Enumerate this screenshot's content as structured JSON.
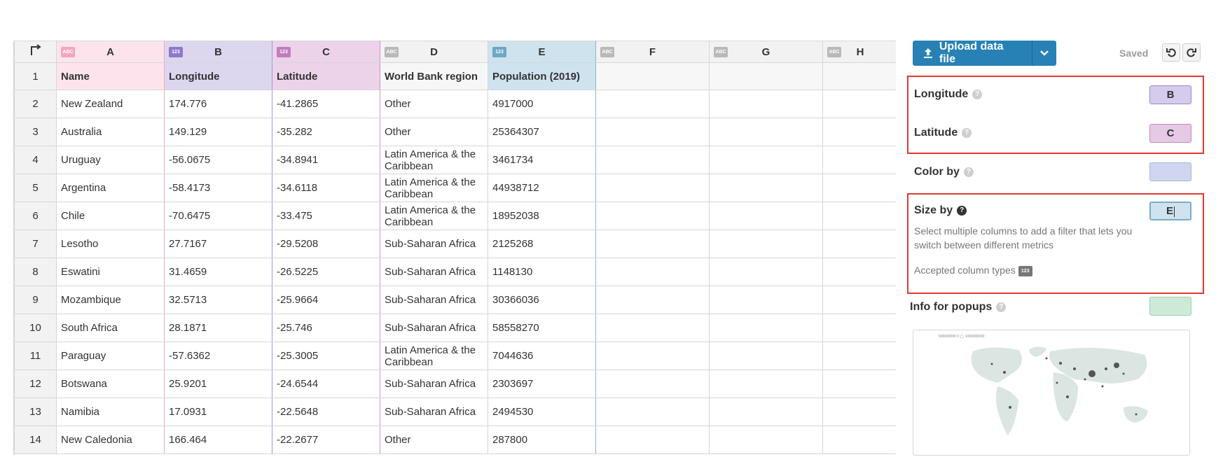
{
  "sheet": {
    "columns": [
      {
        "letter": "A",
        "type": "ABC"
      },
      {
        "letter": "B",
        "type": "123"
      },
      {
        "letter": "C",
        "type": "123"
      },
      {
        "letter": "D",
        "type": "ABC"
      },
      {
        "letter": "E",
        "type": "123"
      },
      {
        "letter": "F",
        "type": "ABC"
      },
      {
        "letter": "G",
        "type": "ABC"
      },
      {
        "letter": "H",
        "type": "ABC"
      }
    ],
    "header_row": {
      "num": "1",
      "cells": [
        "Name",
        "Longitude",
        "Latitude",
        "World Bank region",
        "Population (2019)",
        "",
        "",
        ""
      ]
    },
    "rows": [
      {
        "num": "2",
        "cells": [
          "New Zealand",
          "174.776",
          "-41.2865",
          "Other",
          "4917000"
        ]
      },
      {
        "num": "3",
        "cells": [
          "Australia",
          "149.129",
          "-35.282",
          "Other",
          "25364307"
        ]
      },
      {
        "num": "4",
        "cells": [
          "Uruguay",
          "-56.0675",
          "-34.8941",
          "Latin America & the Caribbean",
          "3461734"
        ]
      },
      {
        "num": "5",
        "cells": [
          "Argentina",
          "-58.4173",
          "-34.6118",
          "Latin America & the Caribbean",
          "44938712"
        ]
      },
      {
        "num": "6",
        "cells": [
          "Chile",
          "-70.6475",
          "-33.475",
          "Latin America & the Caribbean",
          "18952038"
        ]
      },
      {
        "num": "7",
        "cells": [
          "Lesotho",
          "27.7167",
          "-29.5208",
          "Sub-Saharan Africa",
          "2125268"
        ]
      },
      {
        "num": "8",
        "cells": [
          "Eswatini",
          "31.4659",
          "-26.5225",
          "Sub-Saharan Africa",
          "1148130"
        ]
      },
      {
        "num": "9",
        "cells": [
          "Mozambique",
          "32.5713",
          "-25.9664",
          "Sub-Saharan Africa",
          "30366036"
        ]
      },
      {
        "num": "10",
        "cells": [
          "South Africa",
          "28.1871",
          "-25.746",
          "Sub-Saharan Africa",
          "58558270"
        ]
      },
      {
        "num": "11",
        "cells": [
          "Paraguay",
          "-57.6362",
          "-25.3005",
          "Latin America & the Caribbean",
          "7044636"
        ]
      },
      {
        "num": "12",
        "cells": [
          "Botswana",
          "25.9201",
          "-24.6544",
          "Sub-Saharan Africa",
          "2303697"
        ]
      },
      {
        "num": "13",
        "cells": [
          "Namibia",
          "17.0931",
          "-22.5648",
          "Sub-Saharan Africa",
          "2494530"
        ]
      },
      {
        "num": "14",
        "cells": [
          "New Caledonia",
          "166.464",
          "-22.2677",
          "Other",
          "287800"
        ]
      }
    ]
  },
  "panel": {
    "upload_label": "Upload data file",
    "saved_label": "Saved",
    "settings": {
      "longitude": {
        "label": "Longitude",
        "value": "B",
        "help": "?"
      },
      "latitude": {
        "label": "Latitude",
        "value": "C",
        "help": "?"
      },
      "color_by": {
        "label": "Color by",
        "value": "",
        "help": "?"
      },
      "size_by": {
        "label": "Size by",
        "value": "E",
        "help": "?",
        "description": "Select multiple columns to add a filter that lets you switch between different metrics",
        "accepted_label": "Accepted column types",
        "accepted_type": "123"
      },
      "info_popups": {
        "label": "Info for popups",
        "value": "",
        "help": "?"
      }
    },
    "thumbnail": {
      "legend": "500000000 0 ◯ 1000000000"
    }
  },
  "colors": {
    "upload_blue": "#2781b5",
    "highlight_red": "#e0382f",
    "col_a": "#fde4ec",
    "col_b": "#ddd6ef",
    "col_c": "#ecd3ea",
    "col_e": "#cfe3ee"
  }
}
